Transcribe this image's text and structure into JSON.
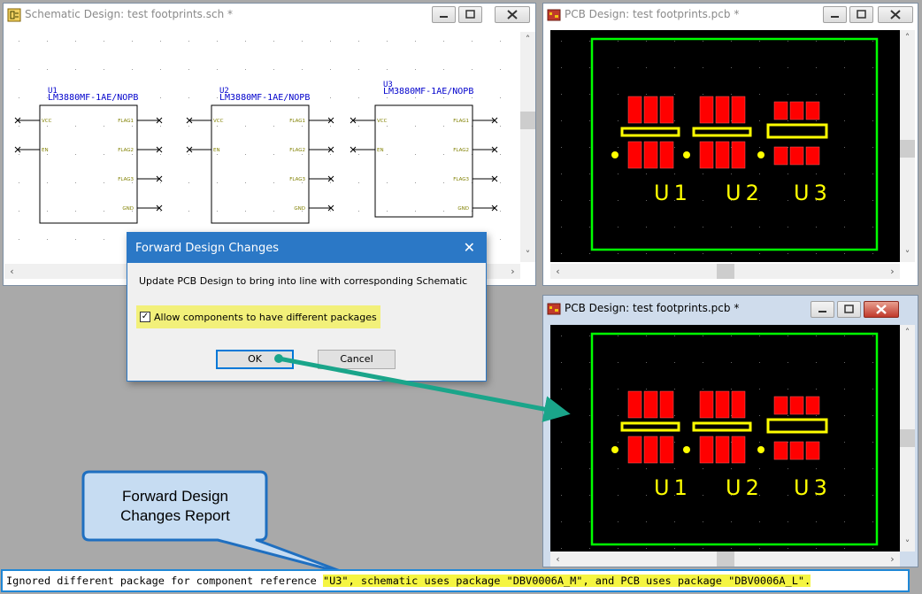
{
  "schematic_window": {
    "title": "Schematic Design: test footprints.sch *",
    "components": [
      {
        "ref": "U1",
        "part": "LM3880MF-1AE/NOPB",
        "left_pins": [
          "VCC",
          "EN"
        ],
        "right_pins": [
          "FLAG1",
          "FLAG2",
          "FLAG3",
          "GND"
        ]
      },
      {
        "ref": "U2",
        "part": "LM3880MF-1AE/NOPB",
        "left_pins": [
          "VCC",
          "EN"
        ],
        "right_pins": [
          "FLAG1",
          "FLAG2",
          "FLAG3",
          "GND"
        ]
      },
      {
        "ref": "U3",
        "part": "LM3880MF-1AE/NOPB",
        "left_pins": [
          "VCC",
          "EN"
        ],
        "right_pins": [
          "FLAG1",
          "FLAG2",
          "FLAG3",
          "GND"
        ]
      }
    ]
  },
  "pcb_window_top": {
    "title": "PCB Design: test footprints.pcb *",
    "labels": [
      "U1",
      "U2",
      "U3"
    ]
  },
  "pcb_window_bottom": {
    "title": "PCB Design: test footprints.pcb *",
    "labels": [
      "U1",
      "U2",
      "U3"
    ]
  },
  "dialog": {
    "title": "Forward Design Changes",
    "close_glyph": "✕",
    "message": "Update PCB Design to bring into line with corresponding Schematic",
    "checkbox_label": "Allow components to have different packages",
    "checkbox_checked": true,
    "ok_label": "OK",
    "cancel_label": "Cancel"
  },
  "callout": {
    "line1": "Forward Design",
    "line2": "Changes Report"
  },
  "report": {
    "prefix": "Ignored different package for component reference ",
    "highlighted": "\"U3\", schematic uses package \"DBV0006A_M\", and PCB uses package \"DBV0006A_L\"."
  },
  "colors": {
    "accent": "#2b78c6",
    "pad_red": "#ff0000",
    "silk_yellow": "#ffff00",
    "board_outline": "#00ff00",
    "schematic_blue": "#0000cc",
    "pin_olive": "#808000",
    "highlight_yellow": "#f5f542",
    "arrow_teal": "#1aa58a"
  }
}
